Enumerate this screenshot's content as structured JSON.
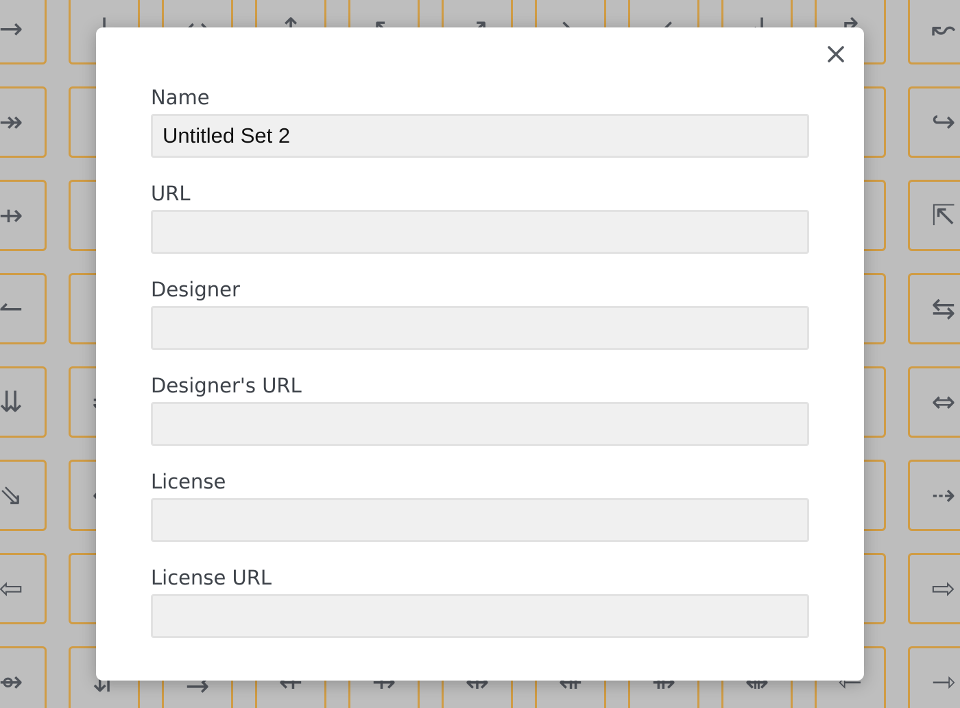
{
  "background_glyphs": {
    "rows": [
      [
        "→",
        "↓",
        "↔",
        "↑",
        "↖",
        "↗",
        "↘",
        "↙",
        "↲",
        "↱",
        "↜"
      ],
      [
        "↠",
        "↡",
        "",
        "",
        "",
        "",
        "",
        "",
        "",
        "",
        "↪"
      ],
      [
        "⇸",
        "↓",
        "",
        "",
        "",
        "",
        "",
        "",
        "",
        "",
        "⇱"
      ],
      [
        "↼",
        "↓",
        "",
        "",
        "",
        "",
        "",
        "",
        "",
        "",
        "⇆"
      ],
      [
        "⇊",
        "⇌",
        "",
        "",
        "",
        "",
        "",
        "",
        "",
        "",
        "⇔"
      ],
      [
        "⇘",
        "↵",
        "",
        "",
        "",
        "",
        "",
        "",
        "",
        "",
        "⇢"
      ],
      [
        "⇦",
        "↑",
        "",
        "",
        "",
        "",
        "",
        "",
        "",
        "",
        "⇨"
      ],
      [
        "⇴",
        "⇵",
        "⇉",
        "⇷",
        "⇸",
        "⇹",
        "⇺",
        "⇻",
        "⇼",
        "⇽",
        "⇾"
      ]
    ],
    "colors": {
      "border": "#e0a33c",
      "glyph": "#4a4f57"
    }
  },
  "modal": {
    "close_icon": "close-icon",
    "fields": {
      "name": {
        "label": "Name",
        "value": "Untitled Set 2",
        "placeholder": ""
      },
      "url": {
        "label": "URL",
        "value": "",
        "placeholder": ""
      },
      "designer": {
        "label": "Designer",
        "value": "",
        "placeholder": ""
      },
      "designer_url": {
        "label": "Designer's URL",
        "value": "",
        "placeholder": ""
      },
      "license": {
        "label": "License",
        "value": "",
        "placeholder": ""
      },
      "license_url": {
        "label": "License URL",
        "value": "",
        "placeholder": ""
      }
    }
  }
}
